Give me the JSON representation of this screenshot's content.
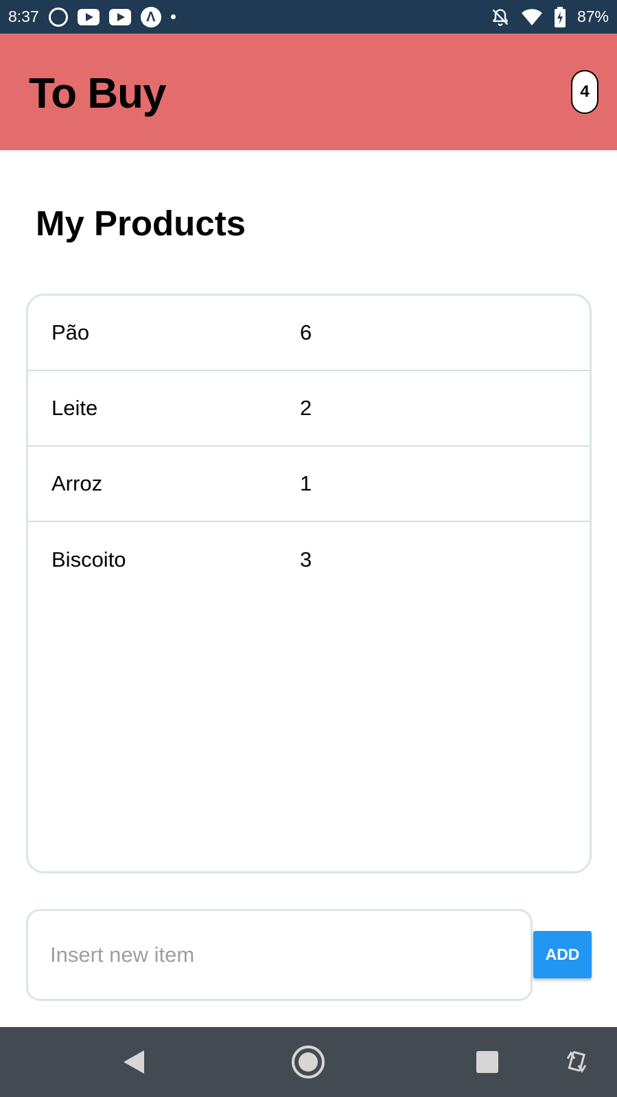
{
  "status_bar": {
    "time": "8:37",
    "battery": "87%",
    "notification_icons": [
      "whatsapp-icon",
      "youtube-icon",
      "youtube-icon",
      "expo-icon",
      "dot-icon"
    ],
    "system_icons": [
      "bell-off-icon",
      "wifi-icon",
      "battery-charging-icon"
    ]
  },
  "header": {
    "title": "To Buy",
    "count": "4",
    "background": "#e36d6d"
  },
  "section": {
    "title": "My Products"
  },
  "products": [
    {
      "name": "Pão",
      "quantity": "6"
    },
    {
      "name": "Leite",
      "quantity": "2"
    },
    {
      "name": "Arroz",
      "quantity": "1"
    },
    {
      "name": "Biscoito",
      "quantity": "3"
    }
  ],
  "new_item": {
    "placeholder": "Insert new item",
    "value": ""
  },
  "add_button": {
    "label": "ADD",
    "color": "#2196f3"
  },
  "nav_bar": {
    "buttons": [
      "back-icon",
      "home-icon",
      "recents-icon",
      "rotate-icon"
    ]
  }
}
